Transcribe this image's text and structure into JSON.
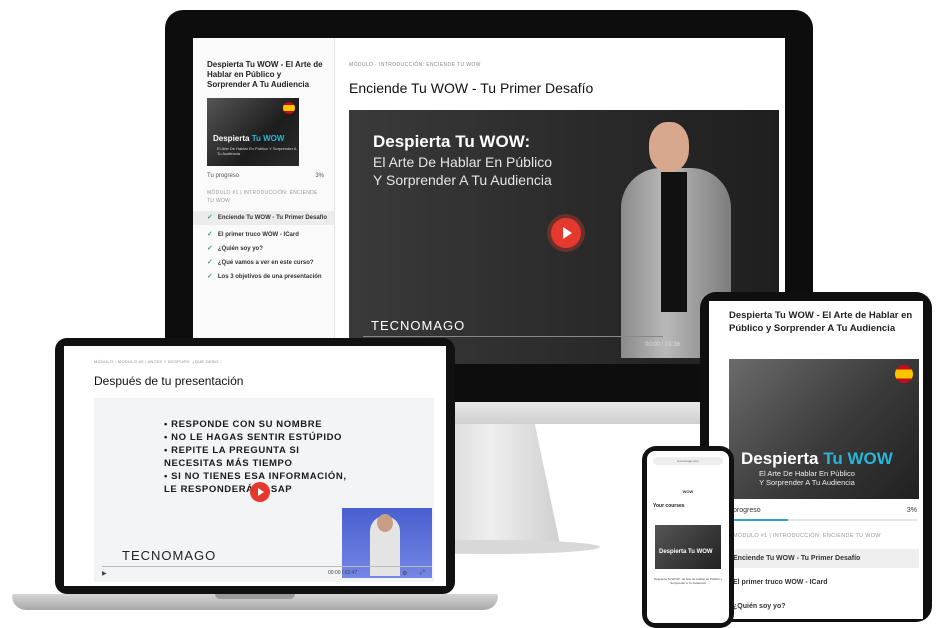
{
  "desktop": {
    "sidebar": {
      "course_title": "Despierta Tu WOW - El Arte de Hablar en Público y Sorprender A Tu Audiencia",
      "thumb_title_a": "Despierta",
      "thumb_title_b": "Tu WOW",
      "thumb_subtitle": "El Arte De Hablar En Público Y Sorprender A Tu Audiencia",
      "progress_label": "Tu progreso",
      "progress_value": "3%",
      "module_label": "MÓDULO #1 | INTRODUCCIÓN: ENCIENDE TU WOW",
      "lessons": [
        {
          "label": "Enciende Tu WOW - Tu Primer Desafío"
        },
        {
          "label": "El primer truco WOW - ICard"
        },
        {
          "label": "¿Quién soy yo?"
        },
        {
          "label": "¿Qué vamos a ver en este curso?"
        },
        {
          "label": "Los 3 objetivos de una presentación"
        }
      ]
    },
    "breadcrumb": "MÓDULO · INTRODUCCIÓN: ENCIENDE TU WOW",
    "lesson_title": "Enciende Tu WOW - Tu Primer Desafío",
    "video": {
      "heading": "Despierta Tu WOW:",
      "line1": "El Arte De Hablar En Público",
      "line2": "Y Sorprender A Tu Audiencia",
      "brand": "TECNOMAGO",
      "time": "00:00 / 03:36"
    }
  },
  "laptop": {
    "breadcrumb": "MÓDULO · MÓDULO #5 | ANTES Y DESPUÉS: ¿QUÉ DEBO...",
    "lesson_title": "Después de tu presentación",
    "slide_bullets": [
      {
        "text": "• RESPONDE CON SU NOMBRE"
      },
      {
        "text": "• NO LE HAGAS SENTIR ESTÚPIDO"
      },
      {
        "text": "• REPITE LA PREGUNTA SI"
      },
      {
        "text": "   NECESITAS MÁS TIEMPO"
      },
      {
        "text": "• SI NO TIENES ESA INFORMACIÓN,"
      },
      {
        "text": "   LE RESPONDERÁS ASAP"
      }
    ],
    "brand": "TECNOMAGO",
    "time": "00:00 / 02:47"
  },
  "tablet": {
    "course_title": "Despierta Tu WOW - El Arte de Hablar en Público y Sorprender A Tu Audiencia",
    "hero_title_a": "Despierta",
    "hero_title_b": "Tu WOW",
    "hero_sub1": "El Arte De Hablar En Público",
    "hero_sub2": "Y Sorprender A Tu Audiencia",
    "progress_label": "progreso",
    "progress_value": "3%",
    "module_label": "MÓDULO #1 | INTRODUCCIÓN: ENCIENDE TU WOW",
    "lessons": [
      {
        "label": "Enciende Tu WOW - Tu Primer Desafío"
      },
      {
        "label": "El primer truco WOW - ICard"
      },
      {
        "label": "¿Quién soy yo?"
      }
    ]
  },
  "phone": {
    "url": "tecnomago.com",
    "logo": "WOW",
    "section_title": "Your courses",
    "card_title": "Despierta Tu WOW",
    "card_desc": "Despierta Tu WOW - El Arte de Hablar en Público y Sorprender A Tu Audiencia"
  }
}
